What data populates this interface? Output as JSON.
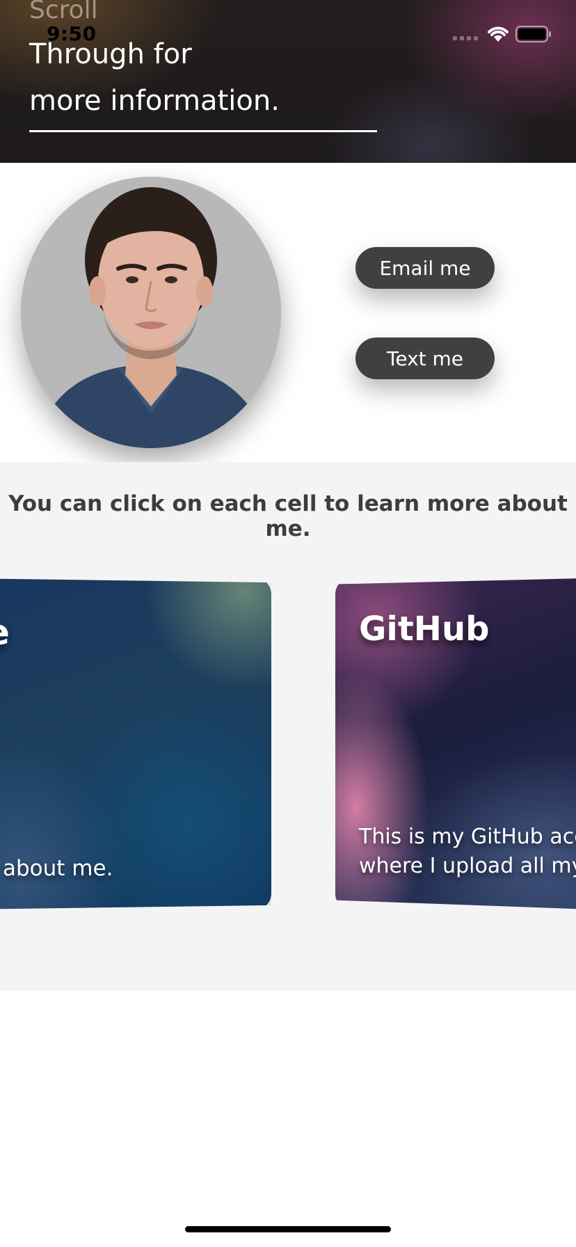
{
  "status_bar": {
    "time": "9:50"
  },
  "header": {
    "scroll_word": "Scroll",
    "line1": "Through for",
    "line2": "more information."
  },
  "profile": {
    "email_button": "Email me",
    "text_button": "Text me"
  },
  "cards_section": {
    "hint": "You can click on each cell to learn more about me.",
    "cards": [
      {
        "title": "e",
        "body": "about me."
      },
      {
        "title": "GitHub",
        "body_line1": "This is my GitHub acco",
        "body_line2": "where I upload all my"
      }
    ]
  },
  "icons": [
    "signal-icon",
    "wifi-icon",
    "battery-icon"
  ]
}
